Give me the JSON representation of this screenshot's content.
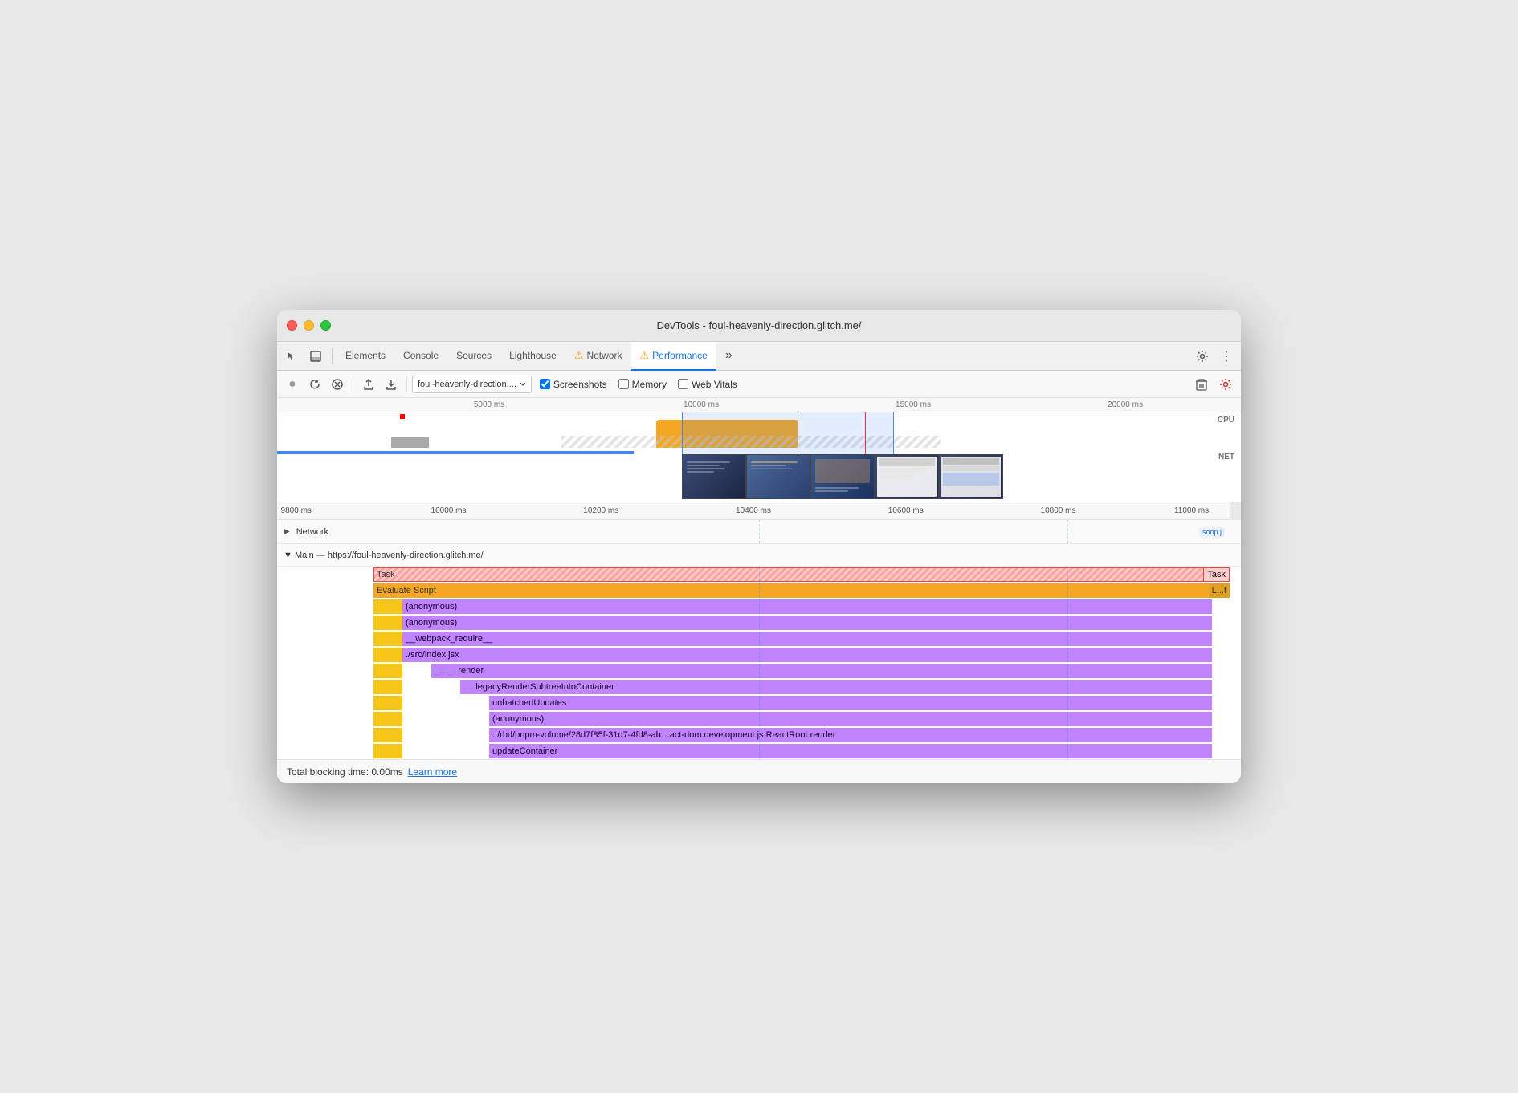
{
  "window": {
    "title": "DevTools - foul-heavenly-direction.glitch.me/"
  },
  "tabs": [
    {
      "id": "pointer",
      "label": "",
      "icon": "▢",
      "type": "icon"
    },
    {
      "id": "elements",
      "label": "Elements",
      "active": false
    },
    {
      "id": "console",
      "label": "Console",
      "active": false
    },
    {
      "id": "sources",
      "label": "Sources",
      "active": false
    },
    {
      "id": "lighthouse",
      "label": "Lighthouse",
      "active": false
    },
    {
      "id": "network",
      "label": "Network",
      "active": false,
      "warn": true
    },
    {
      "id": "performance",
      "label": "Performance",
      "active": true,
      "warn": true
    }
  ],
  "toolbar": {
    "record_label": "●",
    "reload_label": "↺",
    "clear_label": "🚫",
    "upload_label": "⬆",
    "download_label": "⬇",
    "url_value": "foul-heavenly-direction....",
    "screenshots_label": "Screenshots",
    "memory_label": "Memory",
    "web_vitals_label": "Web Vitals"
  },
  "overview": {
    "ruler_ticks": [
      "5000 ms",
      "10000 ms",
      "15000 ms",
      "20000 ms"
    ],
    "cpu_label": "CPU",
    "net_label": "NET"
  },
  "zoomed": {
    "ruler_ticks": [
      "9800 ms",
      "10000 ms",
      "10200 ms",
      "10400 ms",
      "10600 ms",
      "10800 ms",
      "11000 ms"
    ]
  },
  "flame": {
    "network_section": {
      "label": "Network",
      "badge": "soop.j"
    },
    "main_section": {
      "label": "▼ Main — https://foul-heavenly-direction.glitch.me/"
    },
    "rows": [
      {
        "indent": 0,
        "label": "Task",
        "type": "task",
        "extra": "Task"
      },
      {
        "indent": 1,
        "label": "Evaluate Script",
        "type": "eval",
        "extra": "L...t"
      },
      {
        "indent": 2,
        "label": "(anonymous)",
        "type": "purple"
      },
      {
        "indent": 2,
        "label": "(anonymous)",
        "type": "purple"
      },
      {
        "indent": 2,
        "label": "__webpack_require__",
        "type": "purple"
      },
      {
        "indent": 2,
        "label": "./src/index.jsx",
        "type": "purple"
      },
      {
        "indent": 3,
        "label": "render",
        "type": "purple",
        "prefix": "_…_."
      },
      {
        "indent": 3,
        "label": "legacyRenderSubtreeIntoContainer",
        "type": "purple",
        "prefix": "...."
      },
      {
        "indent": 4,
        "label": "unbatchedUpdates",
        "type": "purple"
      },
      {
        "indent": 4,
        "label": "(anonymous)",
        "type": "purple"
      },
      {
        "indent": 4,
        "label": "../rbd/pnpm-volume/28d7f85f-31d7-4fd8-ab…act-dom.development.js.ReactRoot.render",
        "type": "purple"
      },
      {
        "indent": 4,
        "label": "updateContainer",
        "type": "purple"
      }
    ]
  },
  "status_bar": {
    "tbt_label": "Total blocking time: 0.00ms",
    "learn_more": "Learn more"
  }
}
